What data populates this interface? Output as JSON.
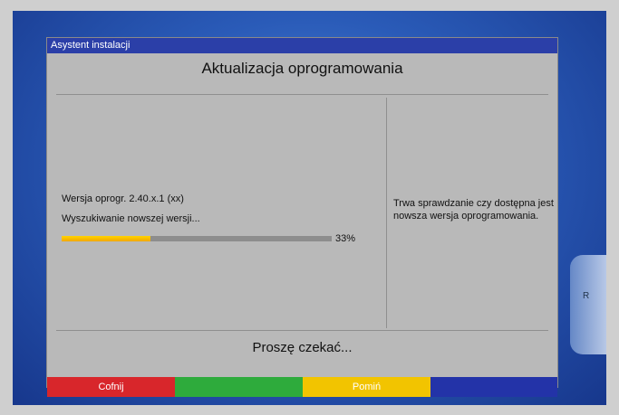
{
  "window": {
    "title": "Asystent instalacji"
  },
  "dialog": {
    "heading": "Aktualizacja oprogramowania",
    "version": "Wersja oprogr. 2.40.x.1 (xx)",
    "status": "Wyszukiwanie nowszej wersji...",
    "progress": {
      "value": 0.33,
      "label": "33%"
    },
    "info": "Trwa sprawdzanie czy dostępna jest nowsza wersja oprogramowania.",
    "footer": "Proszę czekać..."
  },
  "buttons": {
    "red": "Cofnij",
    "green": "",
    "yellow": "Pomiń",
    "blue": ""
  },
  "colors": {
    "titlebar": "#2b3fa8",
    "panel": "#b9b9b9",
    "progress_fill": "#f5b800",
    "red": "#d8262b",
    "green": "#2eab3c",
    "yellow": "#f2c400",
    "blue": "#2333a8"
  }
}
